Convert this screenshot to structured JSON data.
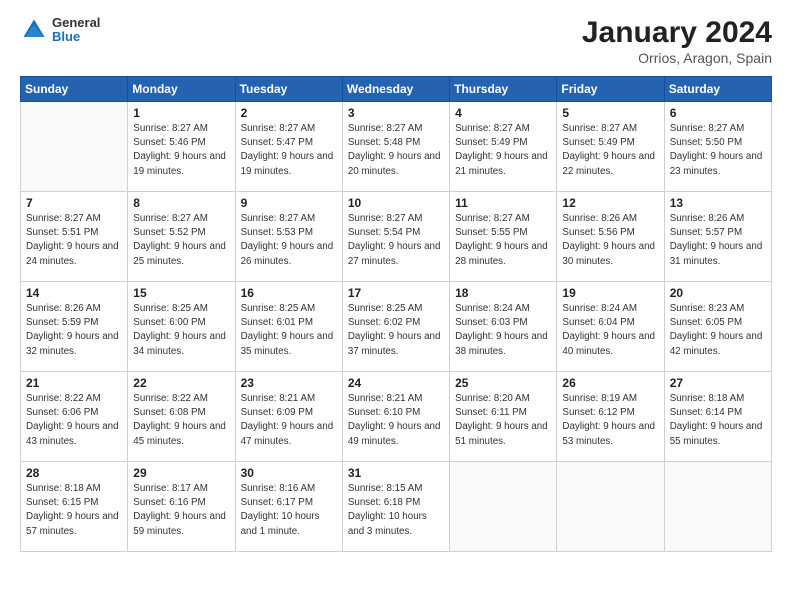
{
  "logo": {
    "general": "General",
    "blue": "Blue"
  },
  "title": {
    "month": "January 2024",
    "location": "Orrios, Aragon, Spain"
  },
  "weekdays": [
    "Sunday",
    "Monday",
    "Tuesday",
    "Wednesday",
    "Thursday",
    "Friday",
    "Saturday"
  ],
  "weeks": [
    [
      {
        "day": null,
        "detail": null
      },
      {
        "day": "1",
        "detail": "Sunrise: 8:27 AM\nSunset: 5:46 PM\nDaylight: 9 hours\nand 19 minutes."
      },
      {
        "day": "2",
        "detail": "Sunrise: 8:27 AM\nSunset: 5:47 PM\nDaylight: 9 hours\nand 19 minutes."
      },
      {
        "day": "3",
        "detail": "Sunrise: 8:27 AM\nSunset: 5:48 PM\nDaylight: 9 hours\nand 20 minutes."
      },
      {
        "day": "4",
        "detail": "Sunrise: 8:27 AM\nSunset: 5:49 PM\nDaylight: 9 hours\nand 21 minutes."
      },
      {
        "day": "5",
        "detail": "Sunrise: 8:27 AM\nSunset: 5:49 PM\nDaylight: 9 hours\nand 22 minutes."
      },
      {
        "day": "6",
        "detail": "Sunrise: 8:27 AM\nSunset: 5:50 PM\nDaylight: 9 hours\nand 23 minutes."
      }
    ],
    [
      {
        "day": "7",
        "detail": "Sunrise: 8:27 AM\nSunset: 5:51 PM\nDaylight: 9 hours\nand 24 minutes."
      },
      {
        "day": "8",
        "detail": "Sunrise: 8:27 AM\nSunset: 5:52 PM\nDaylight: 9 hours\nand 25 minutes."
      },
      {
        "day": "9",
        "detail": "Sunrise: 8:27 AM\nSunset: 5:53 PM\nDaylight: 9 hours\nand 26 minutes."
      },
      {
        "day": "10",
        "detail": "Sunrise: 8:27 AM\nSunset: 5:54 PM\nDaylight: 9 hours\nand 27 minutes."
      },
      {
        "day": "11",
        "detail": "Sunrise: 8:27 AM\nSunset: 5:55 PM\nDaylight: 9 hours\nand 28 minutes."
      },
      {
        "day": "12",
        "detail": "Sunrise: 8:26 AM\nSunset: 5:56 PM\nDaylight: 9 hours\nand 30 minutes."
      },
      {
        "day": "13",
        "detail": "Sunrise: 8:26 AM\nSunset: 5:57 PM\nDaylight: 9 hours\nand 31 minutes."
      }
    ],
    [
      {
        "day": "14",
        "detail": "Sunrise: 8:26 AM\nSunset: 5:59 PM\nDaylight: 9 hours\nand 32 minutes."
      },
      {
        "day": "15",
        "detail": "Sunrise: 8:25 AM\nSunset: 6:00 PM\nDaylight: 9 hours\nand 34 minutes."
      },
      {
        "day": "16",
        "detail": "Sunrise: 8:25 AM\nSunset: 6:01 PM\nDaylight: 9 hours\nand 35 minutes."
      },
      {
        "day": "17",
        "detail": "Sunrise: 8:25 AM\nSunset: 6:02 PM\nDaylight: 9 hours\nand 37 minutes."
      },
      {
        "day": "18",
        "detail": "Sunrise: 8:24 AM\nSunset: 6:03 PM\nDaylight: 9 hours\nand 38 minutes."
      },
      {
        "day": "19",
        "detail": "Sunrise: 8:24 AM\nSunset: 6:04 PM\nDaylight: 9 hours\nand 40 minutes."
      },
      {
        "day": "20",
        "detail": "Sunrise: 8:23 AM\nSunset: 6:05 PM\nDaylight: 9 hours\nand 42 minutes."
      }
    ],
    [
      {
        "day": "21",
        "detail": "Sunrise: 8:22 AM\nSunset: 6:06 PM\nDaylight: 9 hours\nand 43 minutes."
      },
      {
        "day": "22",
        "detail": "Sunrise: 8:22 AM\nSunset: 6:08 PM\nDaylight: 9 hours\nand 45 minutes."
      },
      {
        "day": "23",
        "detail": "Sunrise: 8:21 AM\nSunset: 6:09 PM\nDaylight: 9 hours\nand 47 minutes."
      },
      {
        "day": "24",
        "detail": "Sunrise: 8:21 AM\nSunset: 6:10 PM\nDaylight: 9 hours\nand 49 minutes."
      },
      {
        "day": "25",
        "detail": "Sunrise: 8:20 AM\nSunset: 6:11 PM\nDaylight: 9 hours\nand 51 minutes."
      },
      {
        "day": "26",
        "detail": "Sunrise: 8:19 AM\nSunset: 6:12 PM\nDaylight: 9 hours\nand 53 minutes."
      },
      {
        "day": "27",
        "detail": "Sunrise: 8:18 AM\nSunset: 6:14 PM\nDaylight: 9 hours\nand 55 minutes."
      }
    ],
    [
      {
        "day": "28",
        "detail": "Sunrise: 8:18 AM\nSunset: 6:15 PM\nDaylight: 9 hours\nand 57 minutes."
      },
      {
        "day": "29",
        "detail": "Sunrise: 8:17 AM\nSunset: 6:16 PM\nDaylight: 9 hours\nand 59 minutes."
      },
      {
        "day": "30",
        "detail": "Sunrise: 8:16 AM\nSunset: 6:17 PM\nDaylight: 10 hours\nand 1 minute."
      },
      {
        "day": "31",
        "detail": "Sunrise: 8:15 AM\nSunset: 6:18 PM\nDaylight: 10 hours\nand 3 minutes."
      },
      {
        "day": null,
        "detail": null
      },
      {
        "day": null,
        "detail": null
      },
      {
        "day": null,
        "detail": null
      }
    ]
  ]
}
